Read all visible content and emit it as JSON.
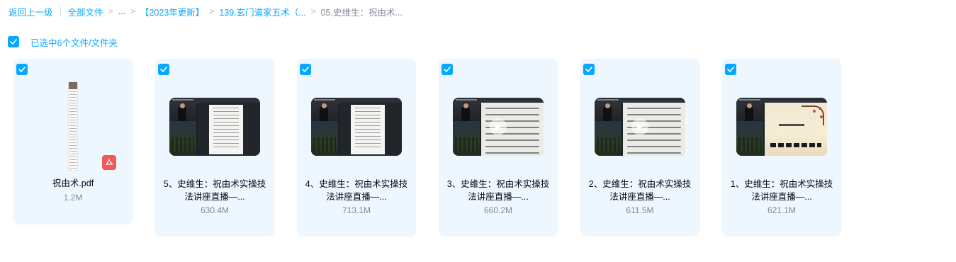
{
  "breadcrumb": {
    "back": "返回上一级",
    "all_files": "全部文件",
    "ellipsis": "...",
    "level1": "【2023年更新】",
    "level2": "139.玄门道家五术（...",
    "current": "05.史维生：祝由术..."
  },
  "selection": {
    "text": "已选中6个文件/文件夹"
  },
  "files": [
    {
      "name": "祝由术.pdf",
      "size": "1.2M",
      "type": "pdf",
      "icon": "pdf-icon"
    },
    {
      "name": "5、史维生：祝由术实操技法讲座直播—...",
      "size": "630.4M",
      "type": "video",
      "thumb": "document-page"
    },
    {
      "name": "4、史维生：祝由术实操技法讲座直播—...",
      "size": "713.1M",
      "type": "video",
      "thumb": "document-page"
    },
    {
      "name": "3、史维生：祝由术实操技法讲座直播—...",
      "size": "660.2M",
      "type": "video",
      "thumb": "handwriting",
      "icon": "play-icon"
    },
    {
      "name": "2、史维生：祝由术实操技法讲座直播—...",
      "size": "611.5M",
      "type": "video",
      "thumb": "handwriting",
      "icon": "play-icon"
    },
    {
      "name": "1、史维生：祝由术实操技法讲座直播—...",
      "size": "621.1M",
      "type": "video",
      "thumb": "painting"
    }
  ],
  "colors": {
    "accent": "#06a7ff",
    "card_bg": "#eef7fe",
    "pdf_red": "#f15a5a",
    "muted": "#818999"
  }
}
